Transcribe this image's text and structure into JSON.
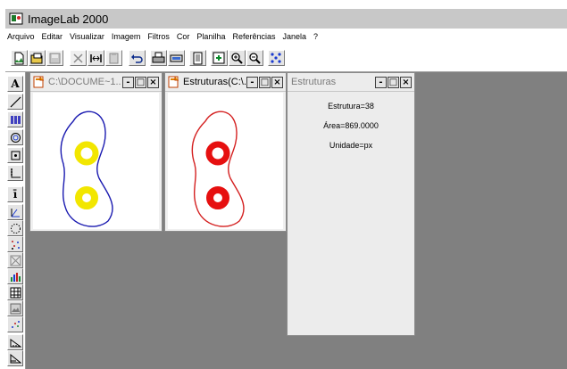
{
  "window": {
    "title": "ImageLab 2000"
  },
  "menu": {
    "items": [
      "Arquivo",
      "Editar",
      "Visualizar",
      "Imagem",
      "Filtros",
      "Cor",
      "Planilha",
      "Referências",
      "Janela",
      "?"
    ]
  },
  "toolbar": {
    "buttons": [
      "new-document",
      "open-document",
      "save-document",
      "cut",
      "crop-pair",
      "paste",
      "undo",
      "print",
      "scan",
      "document",
      "add-image",
      "zoom-in",
      "zoom-out",
      "structure-dots"
    ]
  },
  "palette": {
    "text_tool": "A",
    "bar_tool": "ī"
  },
  "windows": [
    {
      "title": "C:\\DOCUME~1...",
      "active": false,
      "image": "original-image"
    },
    {
      "title": "Estruturas(C:\\...",
      "active": true,
      "image": "structures-image"
    }
  ],
  "info_window": {
    "title": "Estruturas",
    "structure": "Estrutura=38",
    "area": "Área=869.0000",
    "unit": "Unidade=px"
  },
  "colors": {
    "contour_original": "#1a1ab0",
    "contour_structures": "#d42020",
    "spot_original": "#f2e600",
    "spot_structures": "#e61010",
    "workspace": "#808080"
  }
}
